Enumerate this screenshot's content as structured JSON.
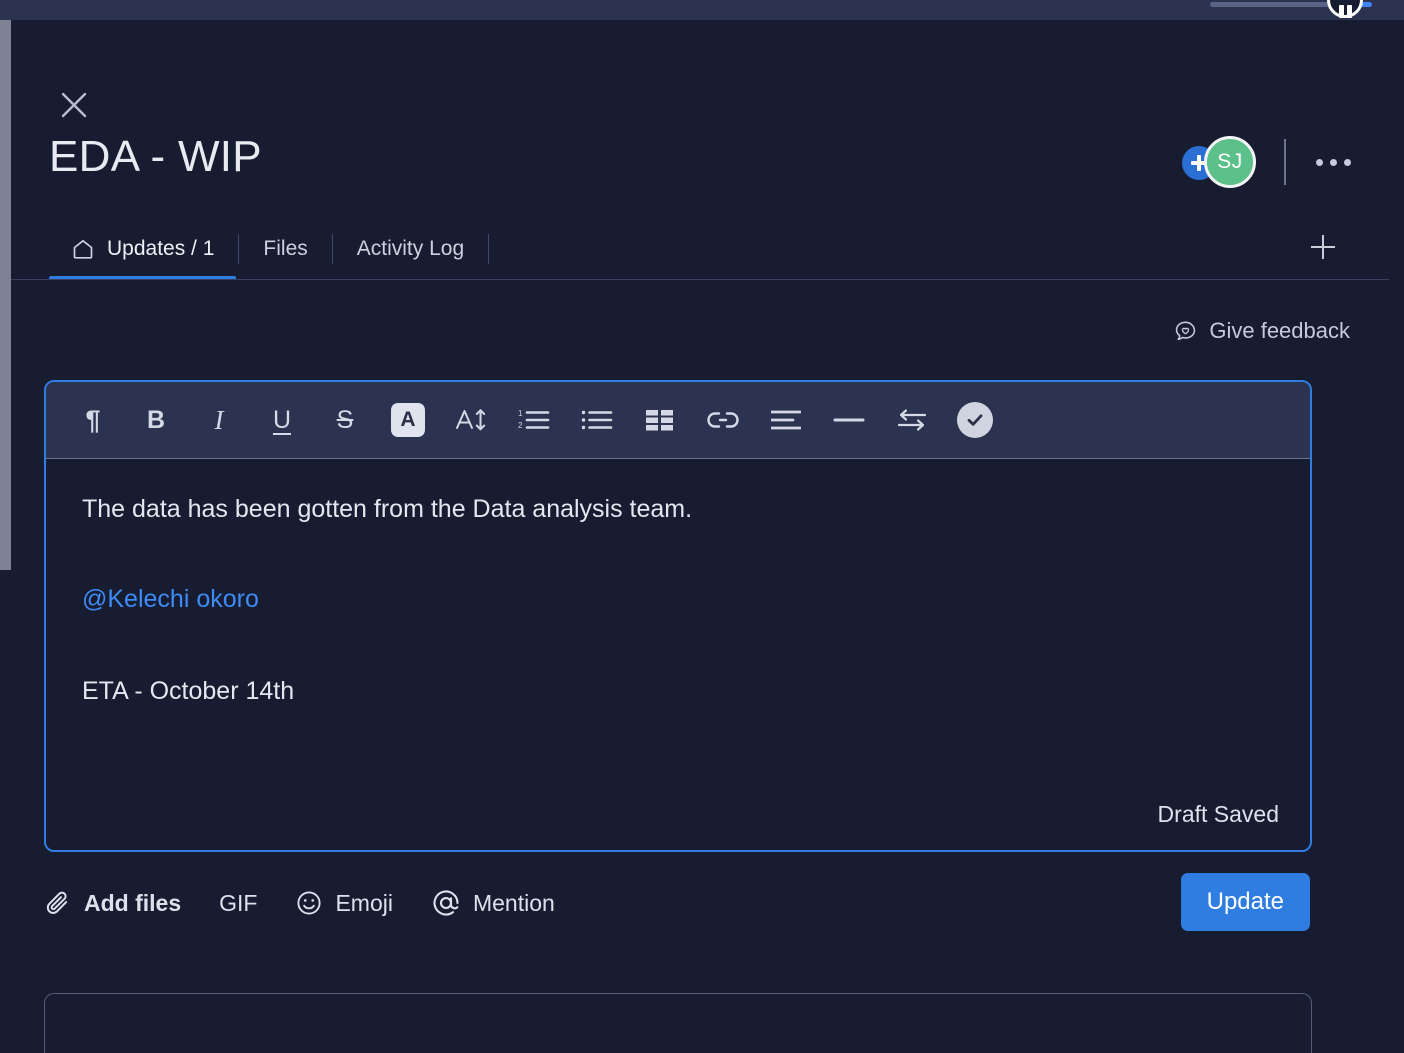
{
  "window": {
    "background_color": "#171c30",
    "accent_color": "#2f7de1"
  },
  "header": {
    "close_icon": "close-icon",
    "title": "EDA - WIP",
    "avatar": {
      "initials": "SJ",
      "color": "#5cc08a",
      "add_icon": "plus-icon",
      "add_color": "#2b6fd4"
    },
    "more_icon": "more-horizontal-icon",
    "add_tab_icon": "plus-icon",
    "tabs": [
      {
        "label": "Updates / 1",
        "icon": "home-icon",
        "active": true
      },
      {
        "label": "Files",
        "active": false
      },
      {
        "label": "Activity Log",
        "active": false
      }
    ]
  },
  "body": {
    "give_feedback": {
      "label": "Give feedback",
      "icon": "chat-heart-icon"
    },
    "editor": {
      "toolbar": [
        {
          "name": "paragraph-format",
          "glyph": "¶"
        },
        {
          "name": "bold",
          "glyph": "B"
        },
        {
          "name": "italic",
          "glyph": "I"
        },
        {
          "name": "underline",
          "glyph": "U"
        },
        {
          "name": "strikethrough",
          "glyph": "S"
        },
        {
          "name": "text-color",
          "glyph": "A"
        },
        {
          "name": "font-size",
          "glyph": "A"
        },
        {
          "name": "numbered-list"
        },
        {
          "name": "bulleted-list"
        },
        {
          "name": "table"
        },
        {
          "name": "link"
        },
        {
          "name": "align-left"
        },
        {
          "name": "horizontal-rule"
        },
        {
          "name": "indent-swap"
        },
        {
          "name": "checklist"
        }
      ],
      "lines": [
        {
          "text": "The data has been gotten from the Data analysis team.",
          "type": "text"
        },
        {
          "text": "@Kelechi okoro",
          "type": "mention"
        },
        {
          "text": "ETA - October 14th",
          "type": "text"
        }
      ],
      "status": "Draft Saved"
    },
    "actions": [
      {
        "label": "Add files",
        "icon": "paperclip-icon",
        "bold": true
      },
      {
        "label": "GIF",
        "icon": "",
        "bold": false
      },
      {
        "label": "Emoji",
        "icon": "smiley-icon",
        "bold": false
      },
      {
        "label": "Mention",
        "icon": "at-icon",
        "bold": false
      }
    ],
    "submit_label": "Update"
  }
}
